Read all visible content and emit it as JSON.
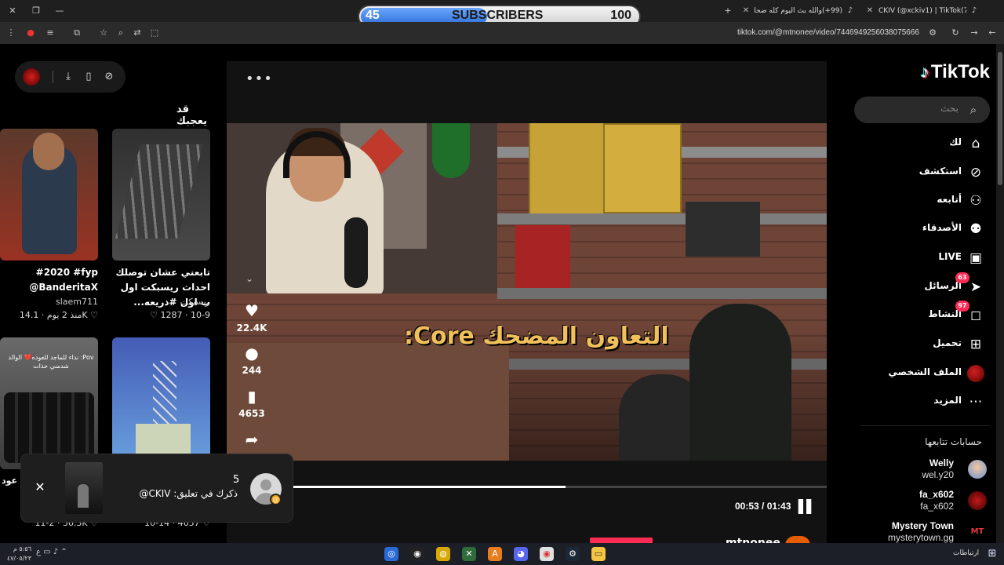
{
  "browser": {
    "tabs": [
      {
        "label": "CKIV (@xckiv1) | TikTok(78)",
        "favicon": "tiktok-icon"
      },
      {
        "label": "(99+)والله بث اليوم كله ضحك",
        "favicon": "tiktok-icon"
      }
    ],
    "url": "tiktok.com/@mtnonee/video/7446949256038075666",
    "subscriber_bar": {
      "left_count": "45",
      "title": "SUBSCRIBERS",
      "right_count": "100",
      "progress": 0.45
    }
  },
  "sidebar": {
    "logo": "TikTok",
    "search_placeholder": "بحث",
    "nav": [
      {
        "label": "لك",
        "icon": "home-icon"
      },
      {
        "label": "استكشف",
        "icon": "compass-icon"
      },
      {
        "label": "أتابعه",
        "icon": "user-follow-icon"
      },
      {
        "label": "الأصدقاء",
        "icon": "friends-icon"
      },
      {
        "label": "LIVE",
        "icon": "live-tv-icon"
      },
      {
        "label": "الرسائل",
        "icon": "messages-icon",
        "badge": "63"
      },
      {
        "label": "النشاط",
        "icon": "activity-icon",
        "badge": "97"
      },
      {
        "label": "تحميل",
        "icon": "upload-icon"
      },
      {
        "label": "الملف الشخصي",
        "icon": "profile-avatar-icon"
      },
      {
        "label": "المزيد",
        "icon": "more-icon"
      }
    ],
    "following_title": "حسابات تتابعها",
    "following": [
      {
        "name": "Welly",
        "handle": "wel.y20"
      },
      {
        "name": "fa_x602",
        "handle": "fa_x602"
      },
      {
        "name": "Mystery Town",
        "handle": "mysterytown.gg"
      }
    ]
  },
  "video": {
    "caption_overlay": "التعاون المضحك Core:",
    "likes": "22.4K",
    "comments": "244",
    "saves": "4653",
    "time": "00:53 / 01:43",
    "progress": 0.51,
    "author": "mtnonee"
  },
  "recommended": {
    "title": "قد يعجبك",
    "items": [
      {
        "caption": "تابعني عشان توصلك احداث ريسبكت اول ب اول #ذريعه...",
        "author": "ريسبكت",
        "likes": "1287",
        "date": "10-9"
      },
      {
        "caption": "#2020 #fyp @BanderitaX",
        "author": "slaem711",
        "likes": "14.1K",
        "date": "منذ 2 يوم"
      },
      {
        "caption": "",
        "author": "",
        "likes": "4657",
        "date": "10-14"
      },
      {
        "caption": "",
        "author": "",
        "likes": "36.3K",
        "date": "11-2"
      }
    ],
    "thumb4_text": "Pov: نداء للماجد للعوده❤️ الوالد شدمني حذات",
    "cut_label": "عود"
  },
  "notification": {
    "count": "5",
    "text": "ذكرك في تعليق: CKIV@"
  },
  "taskbar": {
    "lang": "ارتباطات",
    "time": "٥:٥٦ م",
    "date": "٤٧/٠٥/٢٣"
  },
  "colors": {
    "accent": "#fe2c55",
    "brand_cyan": "#25f4ee",
    "caption_gold": "#f0c05a"
  }
}
